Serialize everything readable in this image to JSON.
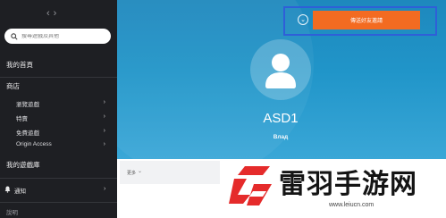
{
  "sidebar": {
    "search_placeholder": "搜尋遊戲及其他",
    "my_home": "我的首頁",
    "store": "商店",
    "store_items": [
      {
        "label": "瀏覽遊戲"
      },
      {
        "label": "特賣"
      },
      {
        "label": "免費遊戲"
      },
      {
        "label": "Origin Access"
      }
    ],
    "my_library": "我的遊戲庫",
    "notifications": "通知",
    "help": "說明"
  },
  "profile": {
    "send_friend_request": "傳送好友邀請",
    "username": "ASD1",
    "subtitle": "Влад",
    "more_label": "更多"
  },
  "watermark": {
    "title": "雷羽手游网",
    "url": "www.leiucn.com"
  },
  "colors": {
    "sidebar_bg": "#1e1f23",
    "profile_bg": "#2095c9",
    "friend_button": "#f36b21",
    "highlight_box": "#2f5fd8",
    "watermark_red": "#e52b2b"
  }
}
